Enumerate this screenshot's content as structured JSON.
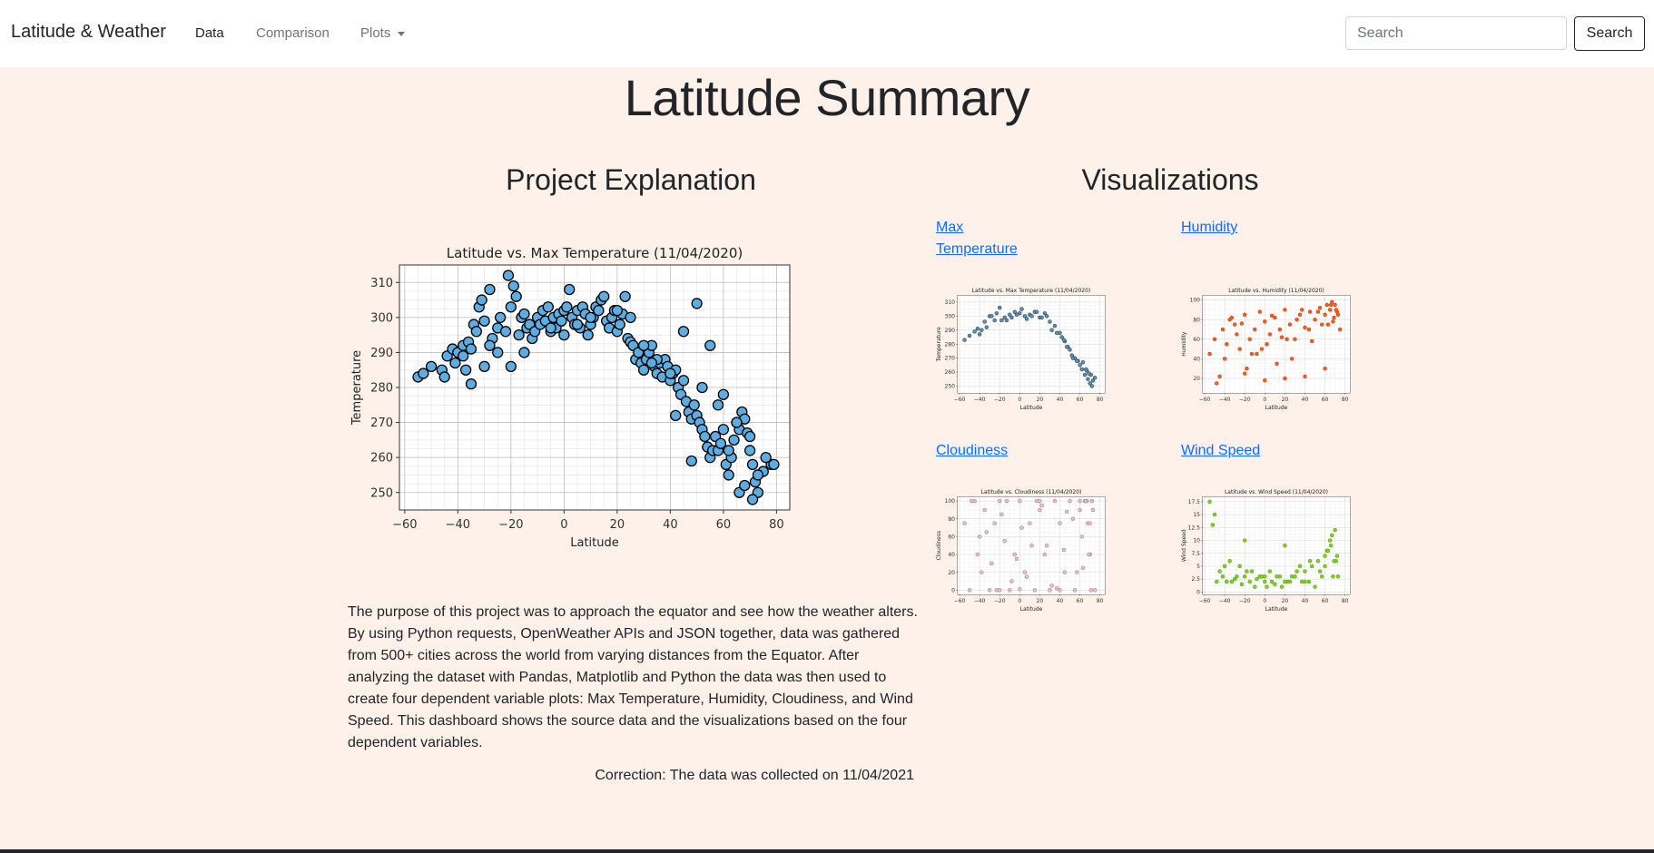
{
  "navbar": {
    "brand": "Latitude & Weather",
    "links": [
      {
        "label": "Data",
        "active": true
      },
      {
        "label": "Comparison",
        "active": false
      },
      {
        "label": "Plots",
        "active": false,
        "dropdown": true
      }
    ],
    "search": {
      "placeholder": "Search",
      "button_label": "Search"
    }
  },
  "page": {
    "title": "Latitude Summary",
    "left_heading": "Project Explanation",
    "right_heading": "Visualizations",
    "paragraph": "The purpose of this project was to approach the equator and see how the weather alters. By using Python requests, OpenWeather APIs and JSON together, data was gathered from 500+ cities across the world from varying distances from the Equator. After analyzing the dataset with Pandas, Matplotlib and Python the data was then used to create four dependent variable plots: Max Temperature, Humidity, Cloudiness, and Wind Speed. This dashboard shows the source data and the visualizations based on the four dependent variables.",
    "correction": "Correction: The data was collected on 11/04/2021"
  },
  "visualizations": [
    {
      "label_line1": "Max",
      "label_line2": "Temperature"
    },
    {
      "label_line1": "Humidity",
      "label_line2": ""
    },
    {
      "label_line1": "Cloudiness",
      "label_line2": ""
    },
    {
      "label_line1": "Wind Speed",
      "label_line2": ""
    }
  ],
  "chart_data": [
    {
      "type": "scatter",
      "title": "Latitude vs. Max Temperature (11/04/2020)",
      "xlabel": "Latitude",
      "ylabel": "Temperature",
      "xlim": [
        -62,
        85
      ],
      "ylim": [
        245,
        315
      ],
      "xticks": [
        -60,
        -40,
        -20,
        0,
        20,
        40,
        60,
        80
      ],
      "yticks": [
        250,
        260,
        270,
        280,
        290,
        300,
        310
      ],
      "grid": true,
      "color": "#5dade2",
      "edge": "#000000",
      "x": [
        -55,
        -53,
        -50,
        -46,
        -45,
        -44,
        -42,
        -41,
        -40,
        -38,
        -37,
        -36,
        -35,
        -34,
        -33,
        -32,
        -31,
        -30,
        -28,
        -27,
        -25,
        -24,
        -22,
        -21,
        -20,
        -19,
        -18,
        -17,
        -16,
        -15,
        -14,
        -13,
        -12,
        -11,
        -10,
        -9,
        -8,
        -7,
        -6,
        -5,
        -4,
        -3,
        -2,
        -1,
        0,
        1,
        2,
        3,
        4,
        5,
        6,
        7,
        8,
        9,
        10,
        11,
        12,
        13,
        14,
        15,
        16,
        17,
        18,
        19,
        20,
        21,
        22,
        23,
        24,
        25,
        26,
        27,
        28,
        29,
        30,
        31,
        32,
        33,
        34,
        35,
        36,
        37,
        38,
        39,
        40,
        41,
        42,
        43,
        44,
        45,
        46,
        47,
        48,
        49,
        50,
        51,
        52,
        53,
        54,
        55,
        56,
        57,
        58,
        59,
        60,
        61,
        62,
        63,
        64,
        65,
        66,
        67,
        68,
        69,
        70,
        71,
        72,
        73,
        75,
        78,
        -35,
        -30,
        -25,
        -20,
        0,
        5,
        25,
        30,
        35,
        40,
        45,
        50,
        55,
        60,
        65,
        70,
        -38,
        -28,
        -15,
        -5,
        10,
        20,
        33,
        42,
        48,
        52,
        58,
        62,
        66,
        68,
        71,
        73,
        76,
        79
      ],
      "y": [
        283,
        284,
        286,
        285,
        283,
        289,
        291,
        287,
        290,
        292,
        285,
        293,
        291,
        298,
        296,
        303,
        305,
        299,
        308,
        294,
        297,
        300,
        296,
        312,
        303,
        309,
        306,
        295,
        300,
        301,
        297,
        298,
        294,
        296,
        300,
        298,
        302,
        299,
        303,
        296,
        300,
        297,
        301,
        299,
        302,
        303,
        308,
        300,
        298,
        302,
        297,
        303,
        301,
        295,
        298,
        300,
        303,
        302,
        305,
        306,
        299,
        297,
        300,
        302,
        296,
        298,
        301,
        306,
        294,
        293,
        292,
        288,
        290,
        287,
        285,
        288,
        290,
        292,
        286,
        284,
        287,
        283,
        288,
        286,
        282,
        284,
        285,
        280,
        278,
        282,
        276,
        273,
        271,
        275,
        272,
        270,
        268,
        266,
        263,
        260,
        262,
        266,
        262,
        264,
        268,
        258,
        255,
        260,
        265,
        270,
        268,
        273,
        271,
        267,
        262,
        258,
        253,
        250,
        256,
        258,
        281,
        286,
        290,
        286,
        295,
        298,
        300,
        292,
        288,
        284,
        296,
        304,
        292,
        278,
        270,
        266,
        289,
        292,
        290,
        297,
        300,
        302,
        287,
        272,
        259,
        280,
        275,
        262,
        250,
        252,
        248,
        255,
        260,
        258
      ]
    },
    {
      "type": "scatter",
      "title": "Latitude vs. Max Temperature (11/04/2020)",
      "xlabel": "Latitude",
      "ylabel": "Temperature",
      "xlim": [
        -62,
        85
      ],
      "ylim": [
        245,
        315
      ],
      "xticks": [
        -60,
        -40,
        -20,
        0,
        20,
        40,
        60,
        80
      ],
      "yticks": [
        250,
        260,
        270,
        280,
        290,
        300,
        310
      ],
      "grid": true,
      "color": "#5d8fb0",
      "edge": "#1a2a3a",
      "x": [
        -55,
        -50,
        -45,
        -42,
        -38,
        -35,
        -30,
        -25,
        -20,
        -15,
        -10,
        -5,
        0,
        5,
        10,
        15,
        20,
        25,
        30,
        35,
        40,
        42,
        45,
        48,
        50,
        52,
        55,
        58,
        60,
        62,
        65,
        68,
        70,
        72,
        75,
        -40,
        -28,
        -18,
        -8,
        2,
        12,
        22,
        32,
        44,
        53,
        63,
        67,
        71,
        73,
        -33,
        -23,
        -13,
        -3,
        7,
        17,
        27,
        37,
        47,
        57,
        66,
        69
      ],
      "y": [
        283,
        286,
        289,
        291,
        290,
        296,
        300,
        297,
        306,
        299,
        301,
        303,
        302,
        300,
        301,
        303,
        299,
        302,
        296,
        293,
        288,
        285,
        282,
        278,
        276,
        272,
        270,
        268,
        265,
        262,
        258,
        255,
        252,
        250,
        256,
        287,
        300,
        297,
        299,
        305,
        300,
        299,
        290,
        283,
        270,
        267,
        261,
        258,
        254,
        292,
        302,
        297,
        301,
        298,
        303,
        300,
        288,
        278,
        268,
        262,
        259
      ]
    },
    {
      "type": "scatter",
      "title": "Latitude vs. Humidity (11/04/2020)",
      "xlabel": "Latitude",
      "ylabel": "Humidity",
      "xlim": [
        -62,
        85
      ],
      "ylim": [
        5,
        105
      ],
      "xticks": [
        -60,
        -40,
        -20,
        0,
        20,
        40,
        60,
        80
      ],
      "yticks": [
        20,
        40,
        60,
        80,
        100
      ],
      "grid": true,
      "color": "#ff5a1f",
      "edge": "#c23a00",
      "x": [
        -55,
        -50,
        -45,
        -42,
        -38,
        -35,
        -30,
        -25,
        -20,
        -15,
        -10,
        -5,
        0,
        5,
        10,
        15,
        20,
        25,
        30,
        35,
        40,
        45,
        50,
        55,
        60,
        62,
        65,
        68,
        70,
        72,
        75,
        -40,
        -28,
        -18,
        -8,
        2,
        12,
        22,
        32,
        44,
        53,
        63,
        67,
        71,
        73,
        -33,
        -23,
        -13,
        -3,
        7,
        17,
        27,
        37,
        47,
        57,
        66,
        69,
        -48,
        -20,
        0,
        20,
        40,
        60
      ],
      "y": [
        45,
        60,
        22,
        70,
        55,
        80,
        75,
        50,
        85,
        60,
        70,
        88,
        78,
        65,
        82,
        70,
        90,
        75,
        60,
        85,
        72,
        88,
        80,
        92,
        85,
        95,
        90,
        78,
        95,
        88,
        70,
        40,
        65,
        30,
        45,
        55,
        35,
        60,
        80,
        70,
        88,
        75,
        98,
        90,
        85,
        82,
        76,
        45,
        50,
        84,
        62,
        40,
        90,
        58,
        75,
        95,
        82,
        15,
        25,
        18,
        20,
        22,
        30
      ]
    },
    {
      "type": "scatter",
      "title": "Latitude vs. Cloudiness (11/04/2020)",
      "xlabel": "Latitude",
      "ylabel": "Cloudiness",
      "xlim": [
        -62,
        85
      ],
      "ylim": [
        -5,
        105
      ],
      "xticks": [
        -60,
        -40,
        -20,
        0,
        20,
        40,
        60,
        80
      ],
      "yticks": [
        0,
        20,
        40,
        60,
        80,
        100
      ],
      "grid": true,
      "color": "#e8c0c8",
      "edge": "#8a6a70",
      "x": [
        -55,
        -50,
        -45,
        -42,
        -38,
        -35,
        -30,
        -25,
        -20,
        -15,
        -10,
        -5,
        0,
        5,
        10,
        15,
        20,
        25,
        30,
        35,
        40,
        45,
        50,
        55,
        60,
        62,
        65,
        68,
        70,
        72,
        75,
        -40,
        -28,
        -18,
        -8,
        2,
        12,
        22,
        32,
        44,
        53,
        63,
        67,
        71,
        73,
        -33,
        -23,
        -13,
        -3,
        7,
        17,
        27,
        37,
        47,
        57,
        66,
        69,
        -48,
        -20,
        0,
        20,
        40,
        60,
        70
      ],
      "y": [
        75,
        0,
        100,
        40,
        20,
        90,
        0,
        75,
        100,
        55,
        0,
        40,
        100,
        20,
        75,
        0,
        90,
        40,
        0,
        100,
        75,
        20,
        100,
        0,
        90,
        60,
        100,
        75,
        40,
        100,
        0,
        60,
        30,
        85,
        10,
        70,
        50,
        95,
        5,
        45,
        80,
        25,
        100,
        0,
        90,
        65,
        0,
        100,
        35,
        15,
        100,
        50,
        2,
        88,
        20,
        100,
        40,
        100,
        0,
        1,
        100,
        0,
        100,
        75
      ]
    },
    {
      "type": "scatter",
      "title": "Latitude vs. Wind Speed (11/04/2020)",
      "xlabel": "Latitude",
      "ylabel": "Wind Speed",
      "xlim": [
        -62,
        85
      ],
      "ylim": [
        -0.5,
        18.5
      ],
      "xticks": [
        -60,
        -40,
        -20,
        0,
        20,
        40,
        60,
        80
      ],
      "yticks": [
        0.0,
        2.5,
        5.0,
        7.5,
        10.0,
        12.5,
        15.0,
        17.5
      ],
      "grid": true,
      "color": "#7ed321",
      "edge": "#4e8a10",
      "x": [
        -55,
        -52,
        -50,
        -45,
        -42,
        -38,
        -35,
        -30,
        -25,
        -20,
        -15,
        -10,
        -5,
        0,
        5,
        10,
        15,
        20,
        25,
        30,
        35,
        40,
        45,
        50,
        55,
        60,
        62,
        65,
        68,
        70,
        72,
        -40,
        -28,
        -18,
        -8,
        2,
        12,
        22,
        32,
        44,
        53,
        63,
        67,
        71,
        73,
        -33,
        -23,
        -13,
        -3,
        7,
        17,
        27,
        37,
        47,
        57,
        66,
        69,
        -48,
        -20,
        0,
        20,
        40,
        60
      ],
      "y": [
        17.5,
        13,
        15,
        4,
        3,
        2,
        6,
        2.5,
        5,
        3,
        2,
        1,
        3,
        2,
        4,
        1.5,
        3,
        9,
        2,
        3,
        5,
        2,
        6,
        1,
        4,
        5,
        8,
        10,
        3,
        12,
        7,
        5,
        3,
        4,
        2.5,
        1,
        3,
        2,
        4,
        2,
        6,
        8,
        11,
        6,
        3,
        2,
        1.5,
        4,
        3,
        2,
        1,
        3,
        2,
        5,
        3,
        9,
        6,
        2,
        10,
        3,
        2,
        4,
        7
      ]
    }
  ]
}
